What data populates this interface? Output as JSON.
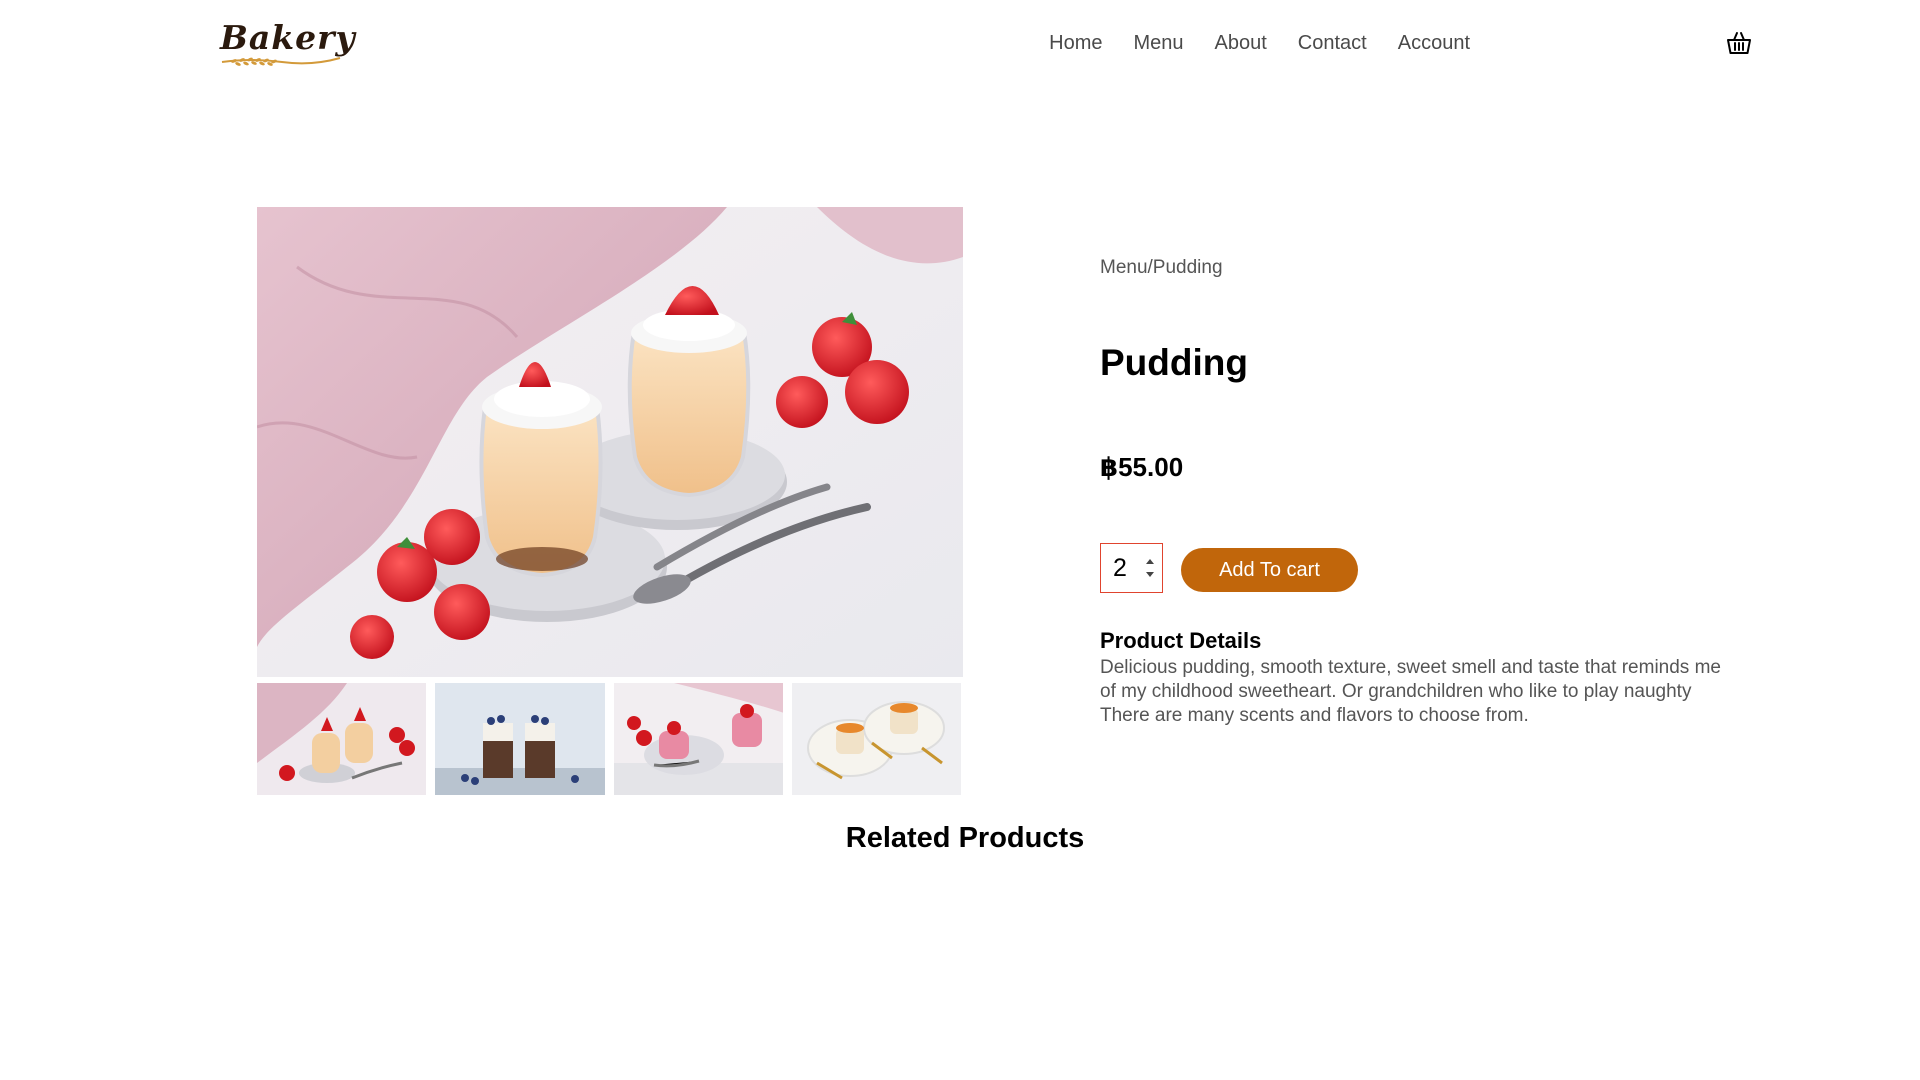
{
  "brand": {
    "logo_text": "Bakery"
  },
  "nav": {
    "items": [
      {
        "label": "Home"
      },
      {
        "label": "Menu"
      },
      {
        "label": "About"
      },
      {
        "label": "Contact"
      },
      {
        "label": "Account"
      }
    ],
    "cart_icon": "basket-icon"
  },
  "product": {
    "breadcrumb": "Menu/Pudding",
    "title": "Pudding",
    "price": "฿55.00",
    "quantity": "2",
    "add_to_cart_label": "Add To cart",
    "details_heading": "Product Details",
    "details_text": "Delicious pudding, smooth texture, sweet smell and taste that reminds me of my childhood sweetheart. Or grandchildren who like to play naughty There are many scents and flavors to choose from.",
    "thumbnails": [
      {
        "name": "strawberry-pudding"
      },
      {
        "name": "blueberry-chocolate-pudding"
      },
      {
        "name": "pink-strawberry-pudding"
      },
      {
        "name": "caramel-pudding"
      }
    ]
  },
  "related": {
    "heading": "Related Products"
  },
  "colors": {
    "accent": "#c1660b",
    "qty_border": "#e0442e",
    "text_muted": "#555555"
  }
}
